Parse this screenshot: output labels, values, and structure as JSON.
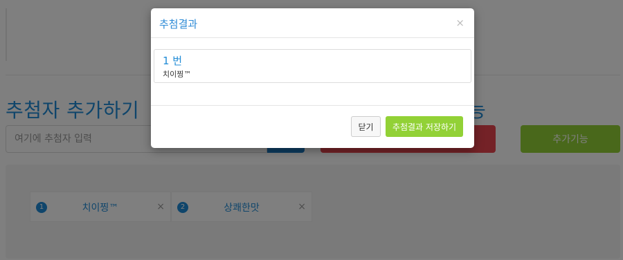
{
  "page": {
    "section_title": "추첨자 추가하기",
    "section_title_right": "능",
    "input_placeholder": "여기에 추첨자 입력",
    "extra_button_label": "추가기능"
  },
  "participants": [
    {
      "number": "1",
      "name": "치이찡™"
    },
    {
      "number": "2",
      "name": "상쾌한맛"
    }
  ],
  "modal": {
    "title": "추첨결과",
    "close_icon": "×",
    "result_number": "1 번",
    "result_name": "치이찡™",
    "close_button_label": "닫기",
    "save_button_label": "추첨결과 저장하기"
  },
  "colors": {
    "accent_blue": "#1f8bd6",
    "green": "#92d136",
    "red": "#e8454f",
    "overlay": "rgba(0,0,0,0.5)"
  }
}
